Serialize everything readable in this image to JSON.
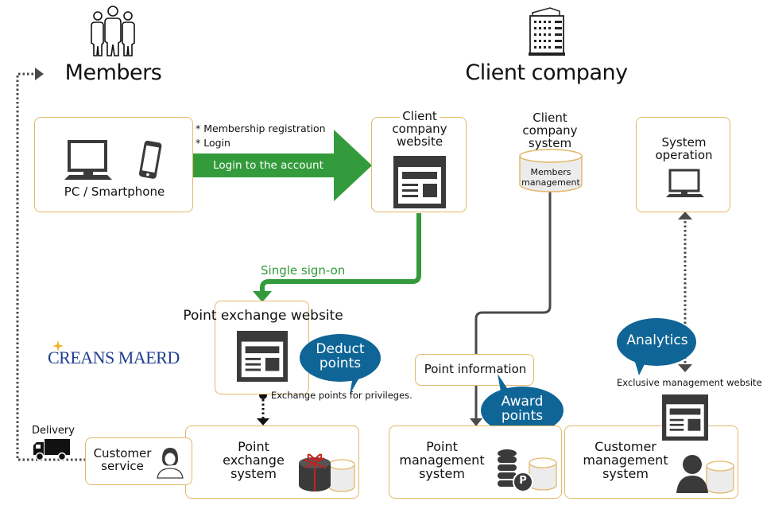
{
  "colors": {
    "box_border": "#e2b86a",
    "green_flow": "#339b3b",
    "dark_connector": "#4a4a4a",
    "bubble_blue": "#0f6596",
    "icon_dark": "#3a3a3a",
    "logo_blue": "#1f3f8f",
    "logo_star": "#f0b323",
    "gift_ribbon": "#c0231f"
  },
  "headers": {
    "members": "Members",
    "client_company": "Client company"
  },
  "devices_box": {
    "label": "PC / Smartphone"
  },
  "login_arrow": {
    "notes": [
      "* Membership registration",
      "* Login"
    ],
    "label": "Login to the account"
  },
  "client_website": {
    "lines": [
      "Client",
      "company",
      "website"
    ]
  },
  "client_system": {
    "lines": [
      "Client",
      "company",
      "system"
    ],
    "db_lines": [
      "Members",
      "management"
    ]
  },
  "system_operation": {
    "lines": [
      "System",
      "operation"
    ]
  },
  "sso": {
    "label": "Single sign-on"
  },
  "point_exchange_website": {
    "label": "Point exchange website"
  },
  "bubbles": {
    "deduct": [
      "Deduct",
      "points"
    ],
    "award": [
      "Award",
      "points"
    ],
    "analytics": "Analytics"
  },
  "exchange_note": "Exchange points for privileges.",
  "point_information": "Point information",
  "exclusive_site": "Exclusive management website",
  "logo": {
    "text": "CREANS MAERD"
  },
  "delivery": "Delivery",
  "customer_service": {
    "lines": [
      "Customer",
      "service"
    ]
  },
  "point_exchange_system": {
    "lines": [
      "Point",
      "exchange",
      "system"
    ]
  },
  "point_management_system": {
    "lines": [
      "Point",
      "management",
      "system"
    ],
    "coin_label": "P"
  },
  "customer_management_system": {
    "lines": [
      "Customer",
      "management",
      "system"
    ]
  }
}
